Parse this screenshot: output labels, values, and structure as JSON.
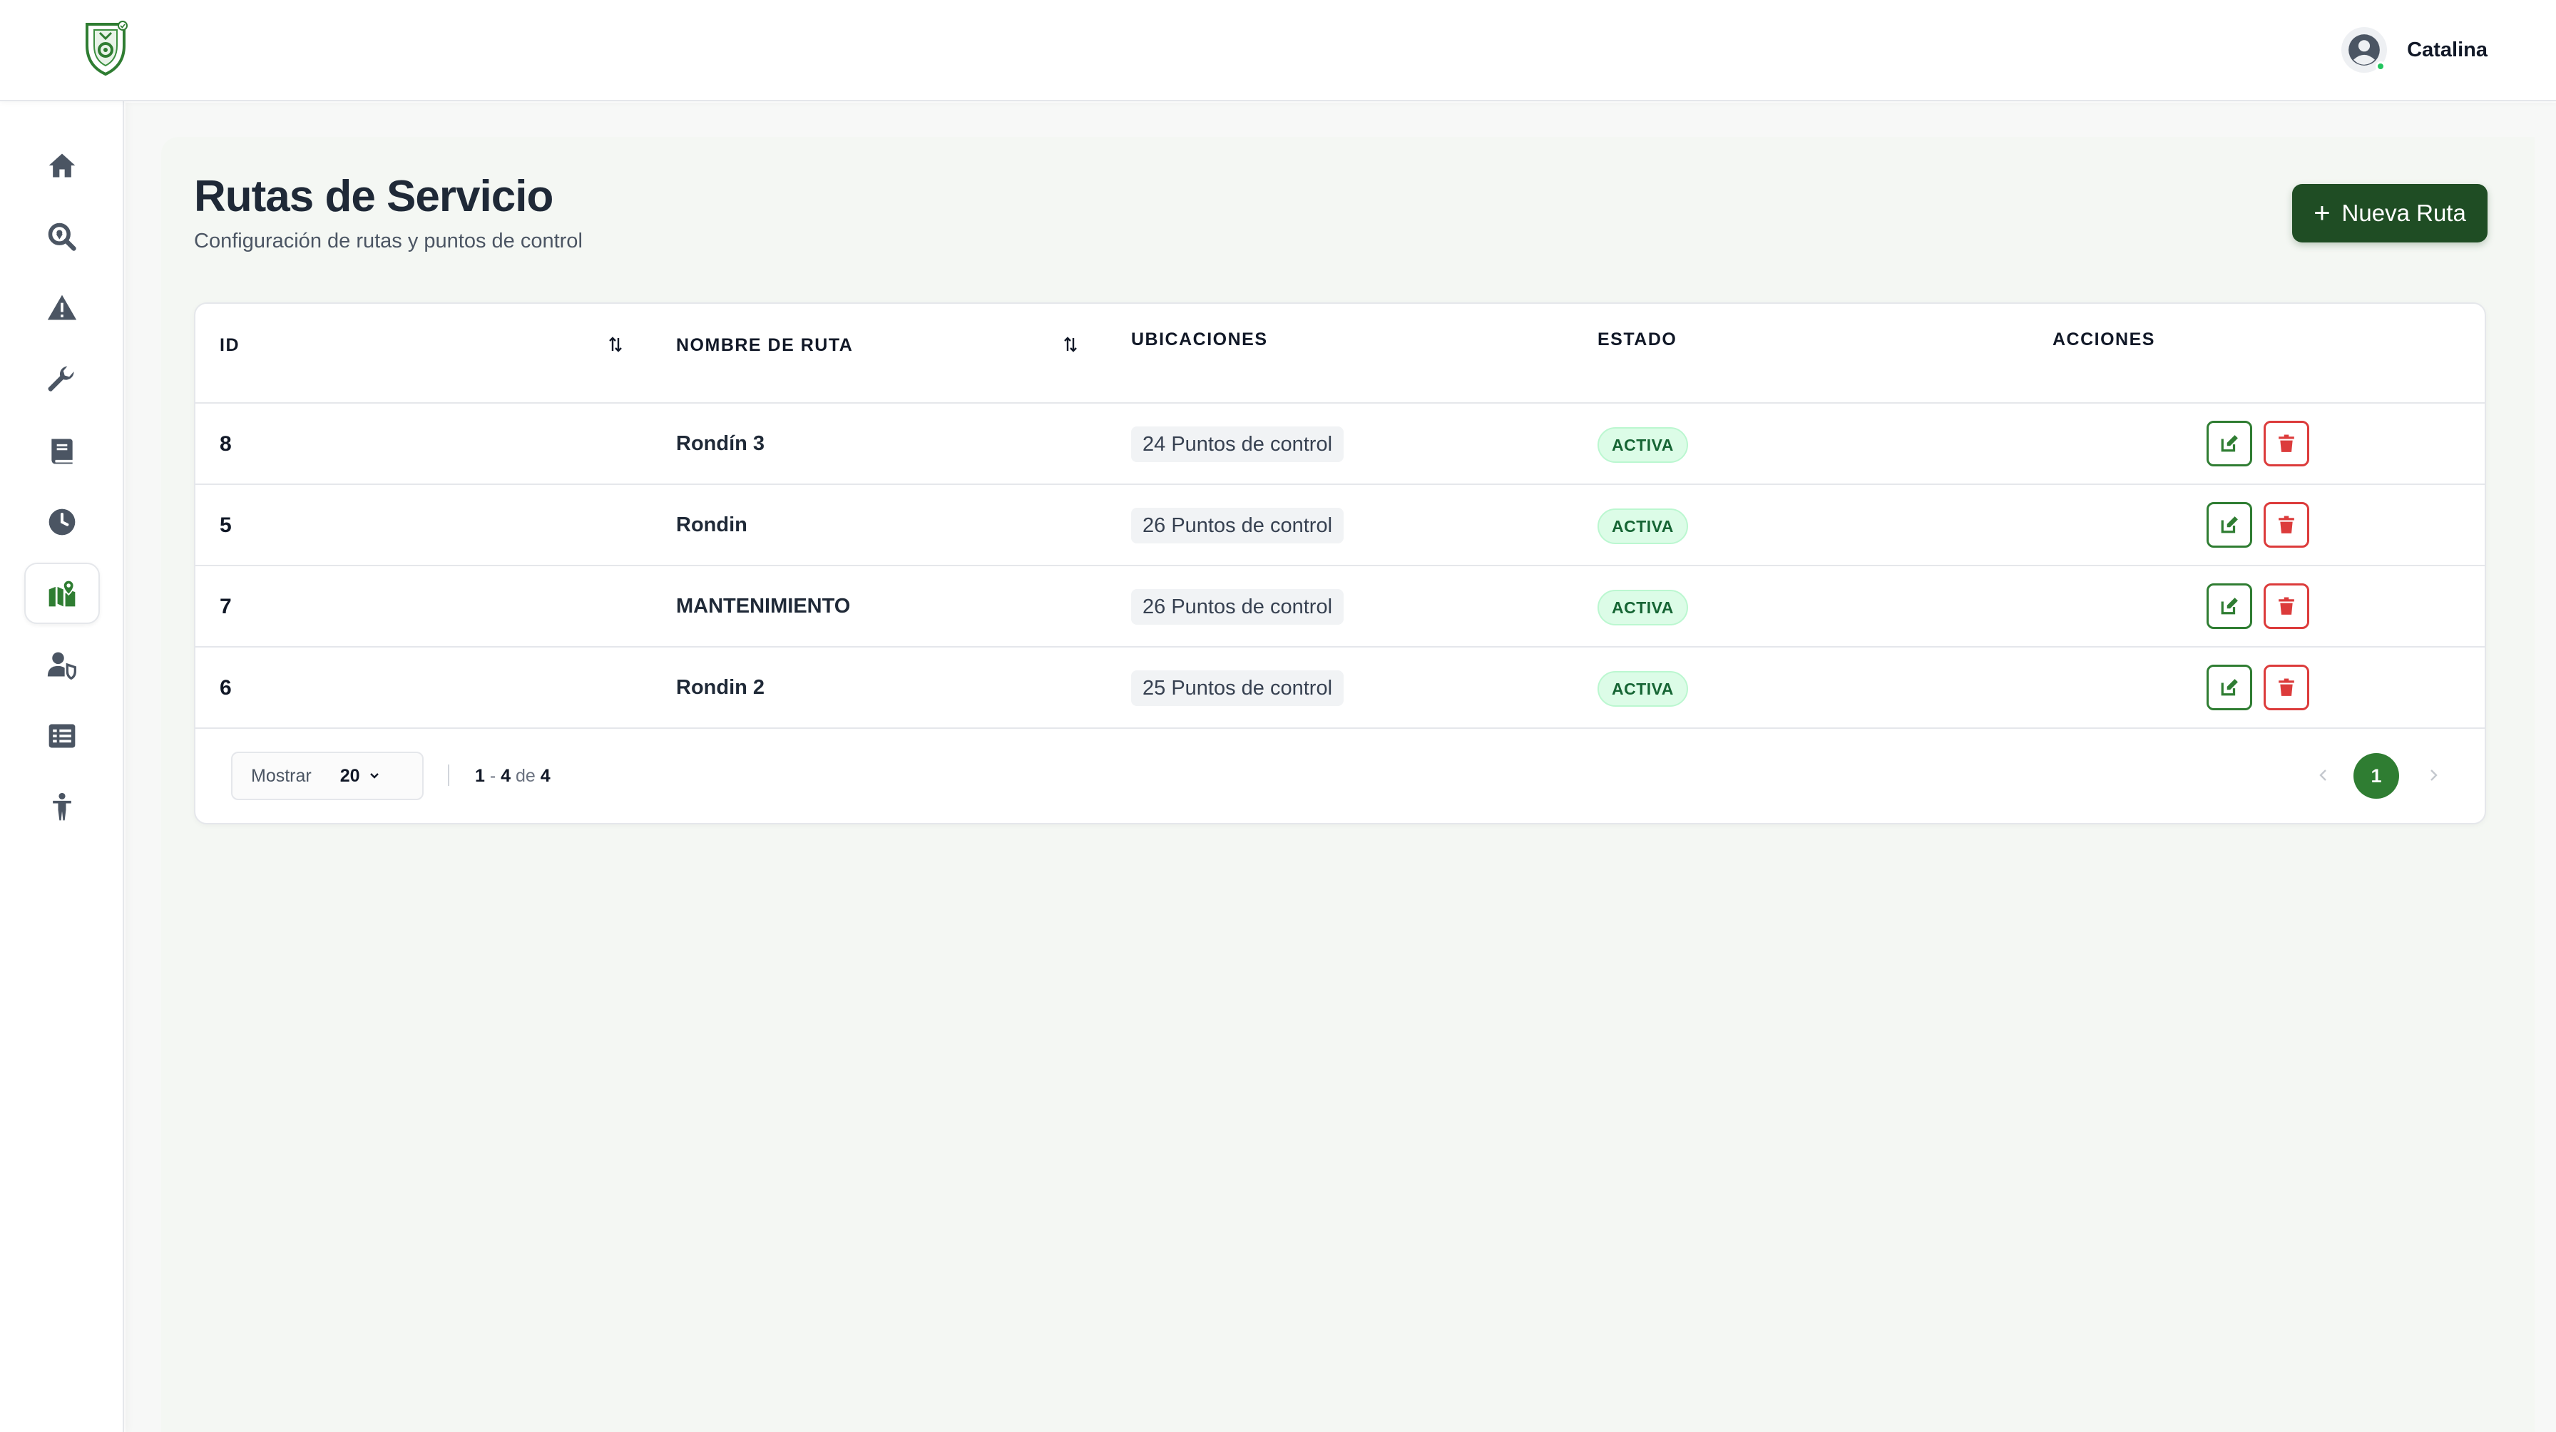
{
  "header": {
    "user_name": "Catalina"
  },
  "sidebar": {
    "items": [
      {
        "name": "home",
        "icon": "home-icon"
      },
      {
        "name": "search-location",
        "icon": "search-location-icon"
      },
      {
        "name": "alerts",
        "icon": "warning-icon"
      },
      {
        "name": "maintenance",
        "icon": "wrench-icon"
      },
      {
        "name": "logbook",
        "icon": "book-icon"
      },
      {
        "name": "history",
        "icon": "clock-icon"
      },
      {
        "name": "routes",
        "icon": "map-marked-icon",
        "active": true
      },
      {
        "name": "users",
        "icon": "user-shield-icon"
      },
      {
        "name": "reports",
        "icon": "list-icon"
      },
      {
        "name": "guards",
        "icon": "person-icon"
      }
    ]
  },
  "page": {
    "title": "Rutas de Servicio",
    "subtitle": "Configuración de rutas y puntos de control",
    "new_button_label": "Nueva Ruta"
  },
  "table": {
    "columns": {
      "id": "ID",
      "name": "NOMBRE DE RUTA",
      "locations": "UBICACIONES",
      "status": "ESTADO",
      "actions": "ACCIONES"
    },
    "rows": [
      {
        "id": "8",
        "name": "Rondín 3",
        "locations": "24 Puntos de control",
        "status": "ACTIVA"
      },
      {
        "id": "5",
        "name": "Rondin",
        "locations": "26 Puntos de control",
        "status": "ACTIVA"
      },
      {
        "id": "7",
        "name": "MANTENIMIENTO",
        "locations": "26 Puntos de control",
        "status": "ACTIVA"
      },
      {
        "id": "6",
        "name": "Rondin 2",
        "locations": "25 Puntos de control",
        "status": "ACTIVA"
      }
    ]
  },
  "pagination": {
    "show_label": "Mostrar",
    "page_size": "20",
    "range_start": "1",
    "range_sep": " - ",
    "range_end": "4",
    "of_label": " de ",
    "total": "4",
    "current_page": "1"
  },
  "colors": {
    "primary_dark": "#1f4d24",
    "primary": "#2f7d32",
    "danger": "#dc3b3b",
    "badge_bg": "#dcfce7",
    "badge_text": "#166534",
    "sidebar_icon": "#4b5563"
  }
}
